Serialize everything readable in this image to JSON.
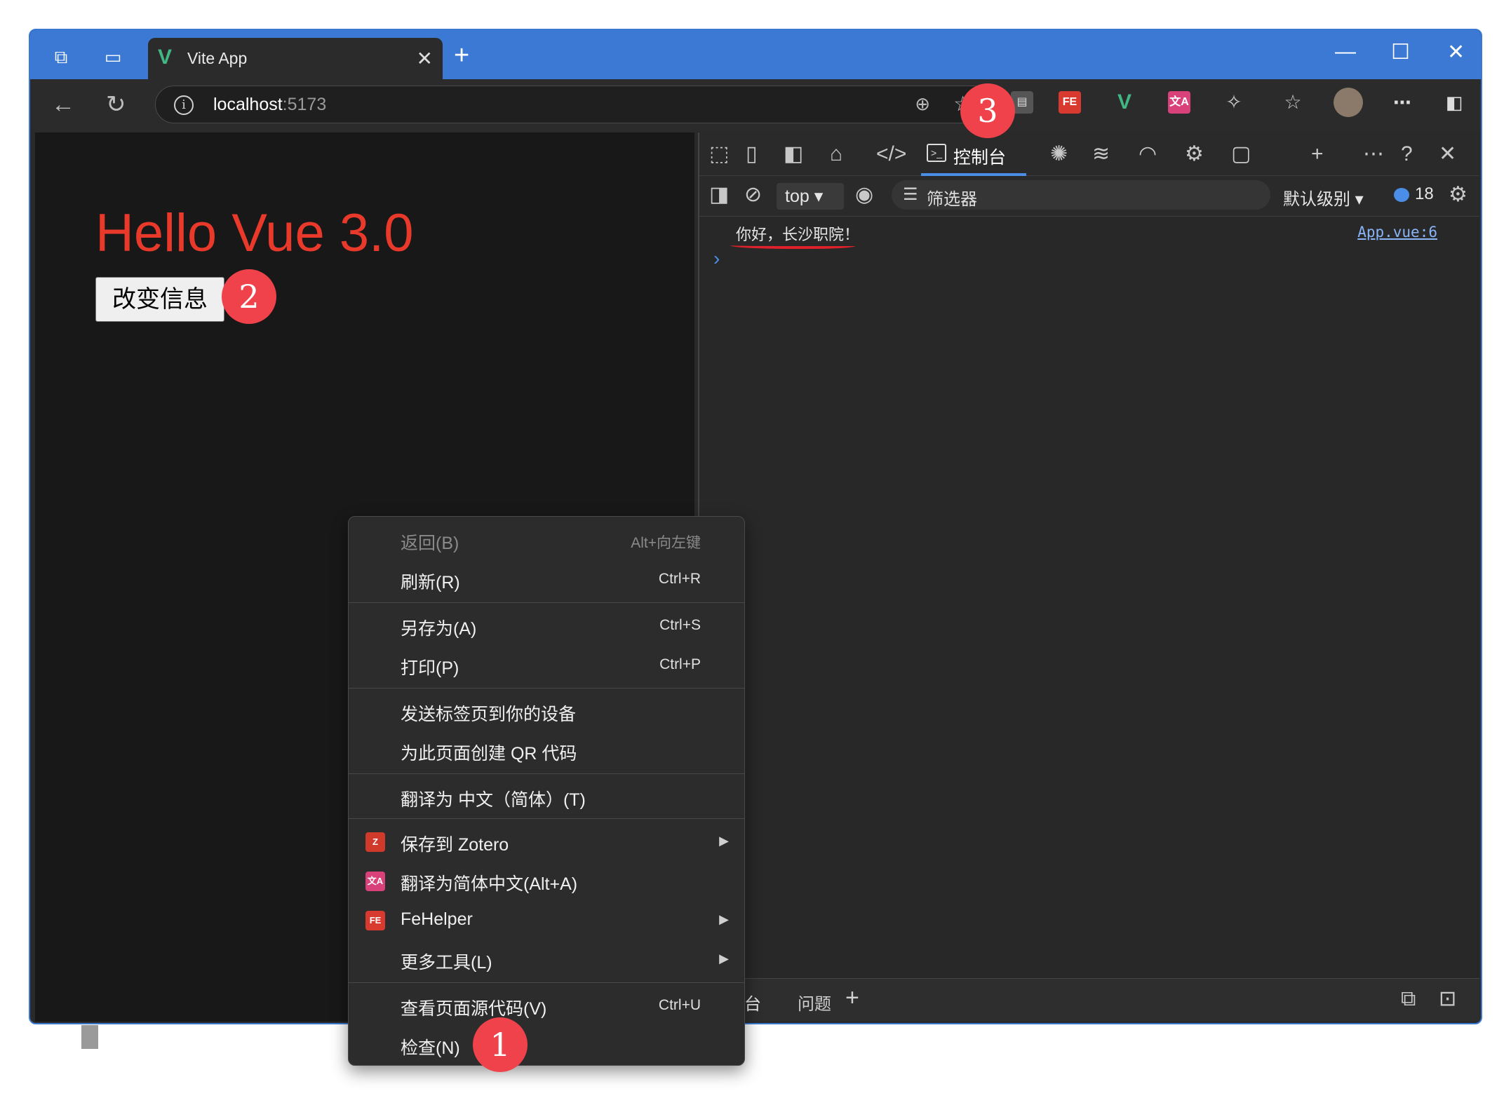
{
  "browser": {
    "tab_title": "Vite App",
    "new_tab": "+",
    "address_host": "localhost",
    "address_port": ":5173"
  },
  "page": {
    "heading": "Hello Vue 3.0",
    "button_label": "改变信息"
  },
  "devtools": {
    "active_tab": "控制台",
    "context": "top",
    "filter_placeholder": "筛选器",
    "level": "默认级别",
    "message_count": "18",
    "log_message": "你好，长沙职院！",
    "log_source": "App.vue:6",
    "drawer_tabs": [
      "台",
      "问题"
    ]
  },
  "context_menu": {
    "items": [
      {
        "label": "返回(B)",
        "shortcut": "Alt+向左键"
      },
      {
        "label": "刷新(R)",
        "shortcut": "Ctrl+R"
      },
      {
        "label": "另存为(A)",
        "shortcut": "Ctrl+S"
      },
      {
        "label": "打印(P)",
        "shortcut": "Ctrl+P"
      },
      {
        "label": "发送标签页到你的设备",
        "shortcut": ""
      },
      {
        "label": "为此页面创建 QR 代码",
        "shortcut": ""
      },
      {
        "label": "翻译为 中文（简体）(T)",
        "shortcut": ""
      },
      {
        "label": "保存到 Zotero",
        "shortcut": ""
      },
      {
        "label": "翻译为简体中文(Alt+A)",
        "shortcut": ""
      },
      {
        "label": "FeHelper",
        "shortcut": ""
      },
      {
        "label": "更多工具(L)",
        "shortcut": ""
      },
      {
        "label": "查看页面源代码(V)",
        "shortcut": "Ctrl+U"
      },
      {
        "label": "检查(N)",
        "shortcut": ""
      }
    ]
  },
  "badges": [
    "1",
    "2",
    "3"
  ],
  "colors": {
    "titlebar": "#3b79d4",
    "heading": "#e8392b",
    "badge": "#f0424a",
    "accent": "#4b8ee8"
  }
}
